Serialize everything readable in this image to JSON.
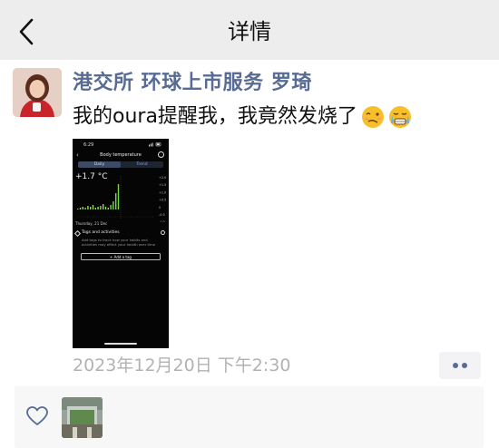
{
  "header": {
    "title": "详情",
    "back_icon": "chevron-left-icon"
  },
  "post": {
    "author": "港交所 环球上市服务 罗琦",
    "text": "我的oura提醒我，我竟然发烧了",
    "emojis": [
      "woozy-face-icon",
      "grimacing-tears-face-icon"
    ],
    "timestamp": "2023年12月20日 下午2:30",
    "more_icon": "more-dots-icon"
  },
  "screenshot": {
    "status_time": "6:29",
    "title": "Body temperature",
    "tab_daily": "Daily",
    "tab_trend": "Trend",
    "value": "+1.7 °C",
    "y_ticks": [
      "+2.0",
      "+1.5",
      "+1.0",
      "+0.5",
      "0",
      "-0.5",
      "-1.0"
    ],
    "date": "Thursday, 21 Dec",
    "tags_title": "Tags and activities",
    "tags_desc": "Add tags to track how your habits and activities may affect your health over time",
    "add_tag_label": "+ Add a tag"
  },
  "likes": {
    "heart_icon": "heart-outline-icon"
  },
  "colors": {
    "link": "#576b95",
    "timestamp": "#b2b2b2",
    "header_bg": "#ededed"
  }
}
